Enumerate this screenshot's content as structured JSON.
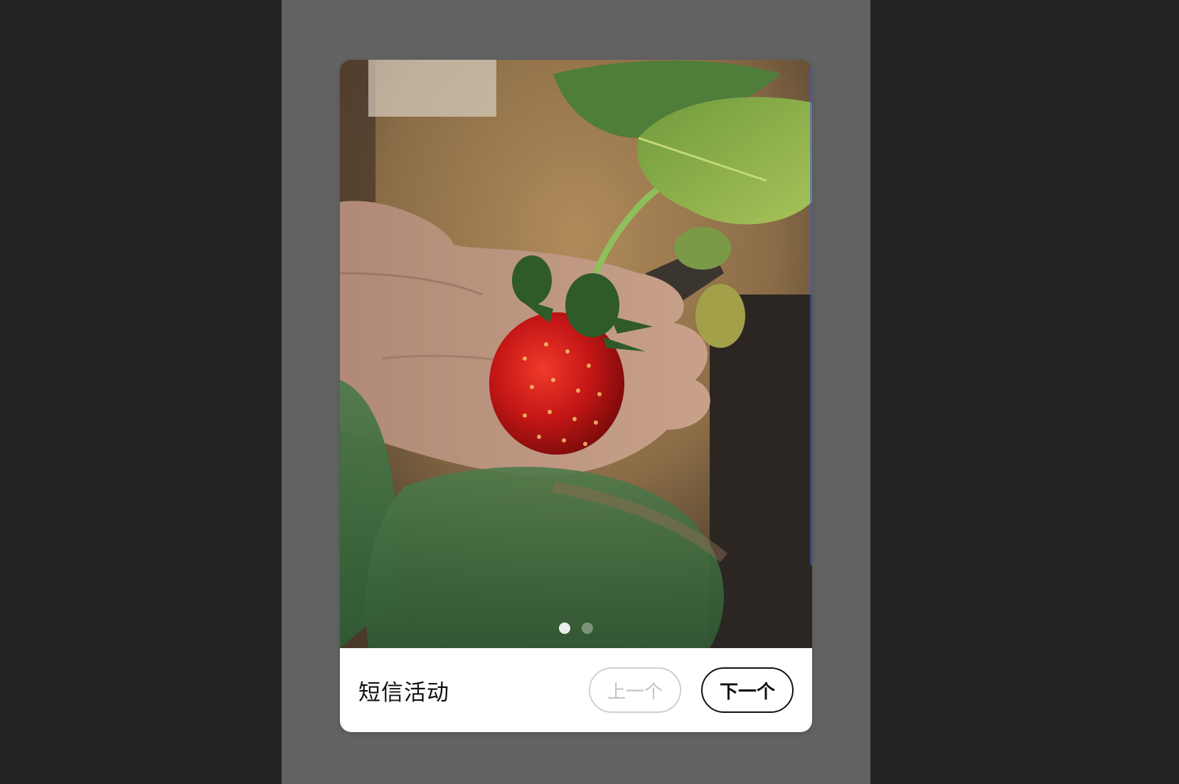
{
  "dialog": {
    "title": "短信活动",
    "prev_label": "上一个",
    "next_label": "下一个",
    "prev_disabled": true,
    "slides_total": 2,
    "slide_current": 1
  },
  "colors": {
    "backdrop": "#232323",
    "overlay": "#636363",
    "button_border_active": "#111111",
    "button_border_disabled": "#cfcfcf"
  }
}
